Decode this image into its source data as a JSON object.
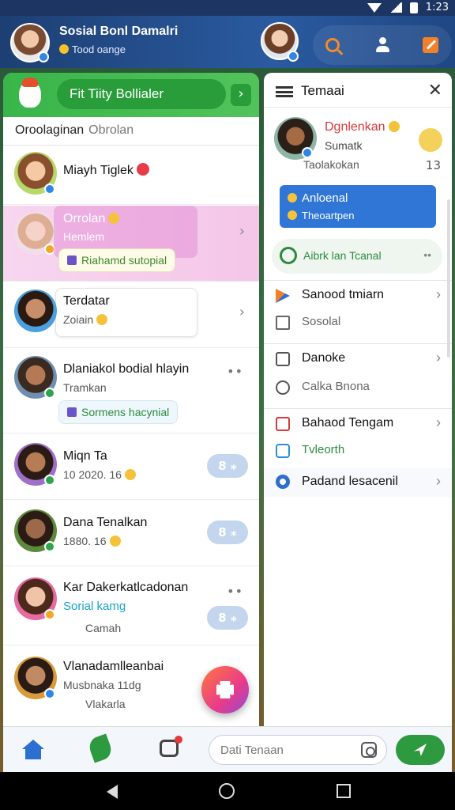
{
  "status_bar": {
    "time": "1:23"
  },
  "header": {
    "title": "Sosial Bonl Damalri",
    "subtitle": "Tood oange"
  },
  "left_panel": {
    "banner_label": "Fit Tiity Bollialer",
    "banner_next": "›",
    "section_title": "Oroolaginan",
    "section_muted": "Obrolan",
    "chats": [
      {
        "name": "Miayh Tiglek",
        "chevron": ""
      },
      {
        "name": "Orrolan",
        "sub": "Hemlem",
        "chip": "Riahamd sutopial",
        "chevron": "›"
      },
      {
        "name": "Terdatar",
        "sub": "Zoiain",
        "chevron": "›"
      },
      {
        "name": "Dlaniakol bodial hlayin",
        "sub": "Tramkan",
        "chip": "Sormens hacynial",
        "more": "••"
      },
      {
        "name": "Miqn Ta",
        "sub": "10 2020. 16",
        "counter": "8 ⁎"
      },
      {
        "name": "Dana Tenalkan",
        "sub": "1880. 16",
        "counter": "8 ⁎"
      },
      {
        "name": "Kar Dakerkatlcadonan",
        "sub_blue": "Sorial kamg",
        "sub": "Camah",
        "counter": "8 ⁎",
        "more": "••"
      },
      {
        "name": "Vlanadamlleanbai",
        "sub": "Musbnaka 11dg",
        "sub2": "Vlakarla"
      }
    ]
  },
  "drawer": {
    "title": "Temaai",
    "close": "✕",
    "profile": {
      "name": "Dgnlenkan",
      "sub": "Sumatk",
      "meta": "Taolakokan",
      "count": "13"
    },
    "blue_card": {
      "line1": "Anloenal",
      "line2": "Theoartpen"
    },
    "green_pill": {
      "label": "Aibrk lan Tcanal",
      "more": "••"
    },
    "items": [
      {
        "label": "Sanood tmiarn",
        "chevron": "›"
      },
      {
        "label": "Sosolal"
      },
      {
        "label": "Danoke",
        "chevron": "›"
      },
      {
        "label": "Calka Bnona"
      },
      {
        "label": "Bahaod Tengam",
        "chevron": "›"
      },
      {
        "label": "Tvleorth"
      },
      {
        "label": "Padand lesacenil",
        "chevron": "›"
      }
    ]
  },
  "bottom_bar": {
    "search_placeholder": "Dati Tenaan"
  },
  "colors": {
    "accent_green": "#39b54a",
    "header_blue": "#2a5aa0",
    "drawer_blue_card": "#2f76d6",
    "profile_name_red": "#d9393a"
  }
}
